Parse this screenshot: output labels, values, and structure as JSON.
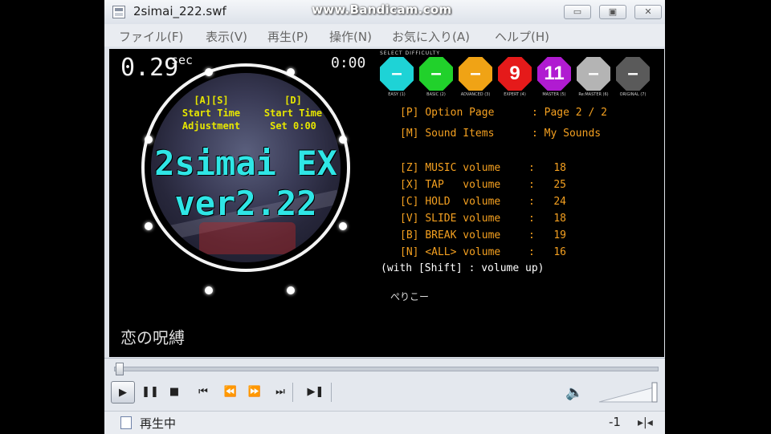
{
  "window": {
    "title": "2simai_222.swf",
    "watermark": "www.Bandicam.com",
    "controls": {
      "minimize": "▭",
      "maximize": "▣",
      "close": "✕"
    }
  },
  "menu": [
    "ファイル(F)",
    "表示(V)",
    "再生(P)",
    "操作(N)",
    "お気に入り(A)",
    "ヘルプ(H)"
  ],
  "game": {
    "elapsed": "0.29",
    "elapsed_unit": "sec",
    "timer": "0:00",
    "hint_left": [
      "[A][S]",
      "Start Time",
      "Adjustment"
    ],
    "hint_right": [
      "[D]",
      "Start Time",
      "Set 0:00"
    ],
    "title_line1": "2simai EX",
    "title_line2": "ver2.22",
    "song_title": "恋の呪縛",
    "difficulty_header": "SELECT DIFFICULTY",
    "difficulties": [
      {
        "label": "–",
        "color": "#1ed3d6",
        "caption": "EASY (1)"
      },
      {
        "label": "–",
        "color": "#21d12b",
        "caption": "BASIC (2)"
      },
      {
        "label": "–",
        "color": "#f0a315",
        "caption": "ADVANCED (3)"
      },
      {
        "label": "9",
        "color": "#e51a1a",
        "caption": "EXPERT (4)"
      },
      {
        "label": "11",
        "color": "#b01bd1",
        "caption": "MASTER (5)"
      },
      {
        "label": "–",
        "color": "#b4b4b4",
        "caption": "Re:MASTER (6)"
      },
      {
        "label": "–",
        "color": "#5a5a5a",
        "caption": "ORIGINAL (7)"
      }
    ],
    "options": [
      {
        "key": "[P]",
        "name": "Option Page",
        "value": "Page 2 / 2"
      },
      {
        "key": "[M]",
        "name": "Sound Items",
        "value": "My Sounds"
      }
    ],
    "volumes": [
      {
        "key": "[Z]",
        "name": "MUSIC volume",
        "value": "18"
      },
      {
        "key": "[X]",
        "name": "TAP   volume",
        "value": "25"
      },
      {
        "key": "[C]",
        "name": "HOLD  volume",
        "value": "24"
      },
      {
        "key": "[V]",
        "name": "SLIDE volume",
        "value": "18"
      },
      {
        "key": "[B]",
        "name": "BREAK volume",
        "value": "19"
      },
      {
        "key": "[N]",
        "name": "<ALL> volume",
        "value": "16"
      }
    ],
    "volume_note": "(with [Shift] : volume up)",
    "comment": "ぺりこー"
  },
  "player": {
    "buttons": [
      "▶",
      "❚❚",
      "■",
      "⏮",
      "⏪",
      "⏩",
      "⏭",
      "▶❚"
    ],
    "button_names": [
      "play-button",
      "pause-button",
      "stop-button",
      "prev-track-button",
      "rewind-button",
      "fast-forward-button",
      "next-track-button",
      "frame-step-button"
    ],
    "speaker_icon": "speaker-icon",
    "seek_position": 0.0
  },
  "status": {
    "text": "再生中",
    "number": "-1",
    "resize_glyph": "▸|◂"
  }
}
